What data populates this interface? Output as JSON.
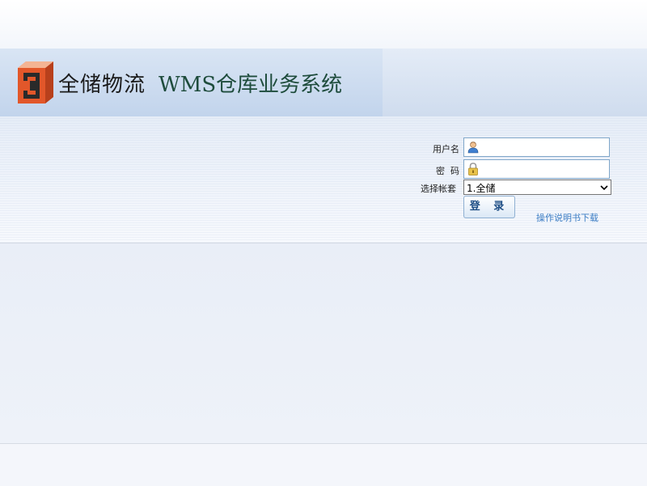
{
  "header": {
    "company_name": "全储物流",
    "system_name": "WMS仓库业务系统",
    "logo_icon": "orange-i-logo",
    "brand_color": "#e2572a"
  },
  "login": {
    "username_label": "用户名",
    "username_value": "",
    "username_icon": "user-icon",
    "password_label": "密  码",
    "password_value": "",
    "password_icon": "lock-icon",
    "account_label": "选择帐套",
    "account_selected": "1.全储",
    "login_button": "登 录",
    "manual_link": "操作说明书下载"
  }
}
